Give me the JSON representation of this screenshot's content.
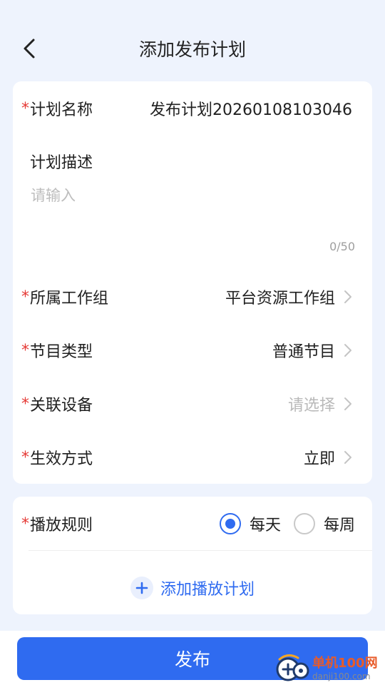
{
  "header": {
    "title": "添加发布计划"
  },
  "form": {
    "plan_name": {
      "required": "*",
      "label": "计划名称",
      "value": "发布计划20260108103046"
    },
    "plan_desc": {
      "label": "计划描述",
      "placeholder": "请输入",
      "counter": "0/50"
    },
    "workgroup": {
      "required": "*",
      "label": "所属工作组",
      "value": "平台资源工作组"
    },
    "program_type": {
      "required": "*",
      "label": "节目类型",
      "value": "普通节目"
    },
    "devices": {
      "required": "*",
      "label": "关联设备",
      "placeholder": "请选择"
    },
    "effect_mode": {
      "required": "*",
      "label": "生效方式",
      "value": "立即"
    }
  },
  "play_rule": {
    "required": "*",
    "label": "播放规则",
    "options": [
      {
        "label": "每天",
        "checked": true
      },
      {
        "label": "每周",
        "checked": false
      }
    ],
    "add_plan_label": "添加播放计划"
  },
  "footer": {
    "publish_label": "发布"
  },
  "watermark": {
    "title": "单机100网",
    "url": "danji100.com"
  },
  "colors": {
    "accent": "#2f6bf0",
    "required": "#e53935",
    "background": "#eef3fd"
  }
}
